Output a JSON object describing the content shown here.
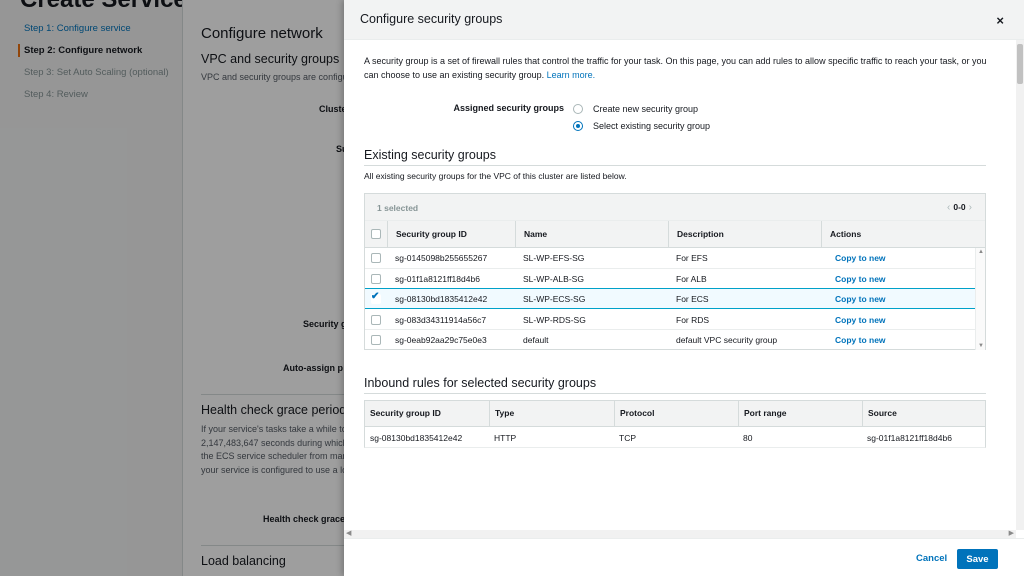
{
  "background": {
    "page_heading": "Create Service",
    "steps": [
      {
        "label": "Step 1: Configure service"
      },
      {
        "label": "Step 2: Configure network"
      },
      {
        "label": "Step 3: Set Auto Scaling (optional)"
      },
      {
        "label": "Step 4: Review"
      }
    ],
    "main_title": "Configure network",
    "vpc_section": "VPC and security groups",
    "vpc_desc": "VPC and security groups are configu",
    "labels": {
      "cluster": "Cluste",
      "subnets": "Su",
      "security_groups": "Security g",
      "auto_assign": "Auto-assign p",
      "health_check_grace": "Health check grace"
    },
    "health_section": "Health check grace period",
    "health_para": [
      "If your service's tasks take a while to",
      "2,147,483,647 seconds during which",
      "the ECS service scheduler from mar",
      "your service is configured to use a lo"
    ],
    "lb_section": "Load balancing"
  },
  "modal": {
    "title": "Configure security groups",
    "close_glyph": "×",
    "intro": "A security group is a set of firewall rules that control the traffic for your task. On this page, you can add rules to allow specific traffic to reach your task, or you can choose to use an existing security group.",
    "learn_more": "Learn more.",
    "assigned_label": "Assigned security groups",
    "radio_options": [
      {
        "label": "Create new security group",
        "selected": false
      },
      {
        "label": "Select existing security group",
        "selected": true
      }
    ],
    "existing": {
      "title": "Existing security groups",
      "description": "All existing security groups for the VPC of this cluster are listed below.",
      "selected_count": "1 selected",
      "pager_prev": "‹",
      "pager_label": "0-0",
      "pager_next": "›",
      "columns": [
        "Security group ID",
        "Name",
        "Description",
        "Actions"
      ],
      "rows": [
        {
          "id": "sg-0145098b255655267",
          "name": "SL-WP-EFS-SG",
          "description": "For EFS",
          "action": "Copy to new",
          "checked": false
        },
        {
          "id": "sg-01f1a8121ff18d4b6",
          "name": "SL-WP-ALB-SG",
          "description": "For ALB",
          "action": "Copy to new",
          "checked": false
        },
        {
          "id": "sg-08130bd1835412e42",
          "name": "SL-WP-ECS-SG",
          "description": "For ECS",
          "action": "Copy to new",
          "checked": true
        },
        {
          "id": "sg-083d34311914a56c7",
          "name": "SL-WP-RDS-SG",
          "description": "For RDS",
          "action": "Copy to new",
          "checked": false
        },
        {
          "id": "sg-0eab92aa29c75e0e3",
          "name": "default",
          "description": "default VPC security group",
          "action": "Copy to new",
          "checked": false
        }
      ]
    },
    "inbound": {
      "title": "Inbound rules for selected security groups",
      "columns": [
        "Security group ID",
        "Type",
        "Protocol",
        "Port range",
        "Source"
      ],
      "rows": [
        {
          "id": "sg-08130bd1835412e42",
          "type": "HTTP",
          "protocol": "TCP",
          "port_range": "80",
          "source": "sg-01f1a8121ff18d4b6"
        }
      ]
    },
    "footer": {
      "cancel": "Cancel",
      "save": "Save"
    }
  },
  "colors": {
    "accent": "#0073bb",
    "active_step": "#ec7211",
    "selected_row_bg": "#f1faff",
    "selected_row_border": "#00a1c9"
  }
}
